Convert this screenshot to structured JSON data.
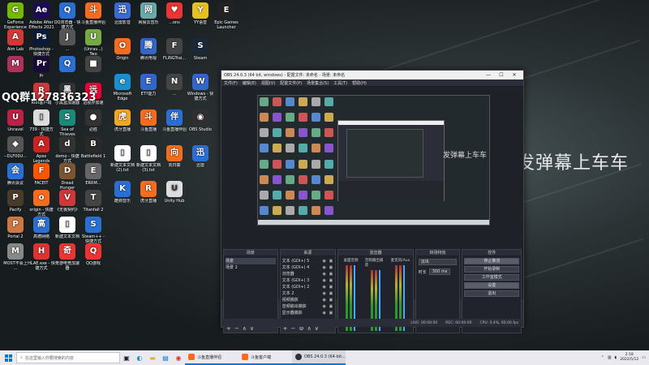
{
  "desktop": {
    "icons": [
      {
        "label": "GeForce Experience",
        "color": "#76b900",
        "glyph": "G"
      },
      {
        "label": "Adobe After Effects 2021",
        "color": "#1f0a5a",
        "glyph": "Ae"
      },
      {
        "label": "QQ浏览器 - 快捷方式",
        "color": "#2a6fd6",
        "glyph": "Q"
      },
      {
        "label": "斗鱼直播伴侣",
        "color": "#f56c1e",
        "glyph": "斗"
      },
      {
        "label": "Aim Lab",
        "color": "#d23838",
        "glyph": "A"
      },
      {
        "label": "Photoshop - 快捷方式",
        "color": "#0a1a3a",
        "glyph": "Ps"
      },
      {
        "label": "...",
        "color": "#555",
        "glyph": "J"
      },
      {
        "label": "(Unrav...) Two",
        "color": "#7a4",
        "glyph": "U"
      },
      {
        "label": "",
        "color": "#b0305a",
        "glyph": "M"
      },
      {
        "label": "Pr",
        "color": "#1a0a3a",
        "glyph": "Pr"
      },
      {
        "label": "",
        "color": "#2a6fd6",
        "glyph": "Q"
      },
      {
        "label": "",
        "color": "#444",
        "glyph": "■"
      },
      {
        "label": "QQ群127836323",
        "color": "transparent",
        "glyph": ""
      },
      {
        "label": "Riot客户端",
        "color": "#d13639",
        "glyph": "R"
      },
      {
        "label": "小黑盒加速器",
        "color": "#333",
        "glyph": "黑"
      },
      {
        "label": "远视界加速",
        "color": "#e03",
        "glyph": "远"
      },
      {
        "label": "Unravel",
        "color": "#b24",
        "glyph": "U"
      },
      {
        "label": "739 - 快捷方式",
        "color": "#ddd",
        "glyph": "▯"
      },
      {
        "label": "Sea of Thieves",
        "color": "#1a8a7a",
        "glyph": "S"
      },
      {
        "label": "必胜",
        "color": "#333",
        "glyph": "●"
      },
      {
        "label": "--DLF00U...",
        "color": "#555",
        "glyph": "◆"
      },
      {
        "label": "Apex Legends",
        "color": "#c22",
        "glyph": "A"
      },
      {
        "label": "demo - 快捷方式",
        "color": "#333",
        "glyph": "d"
      },
      {
        "label": "Battlefield 1",
        "color": "#2a2a2a",
        "glyph": "B"
      },
      {
        "label": "腾讯会议",
        "color": "#2a6fd6",
        "glyph": "会"
      },
      {
        "label": "FACEIT",
        "color": "#f50",
        "glyph": "F"
      },
      {
        "label": "Dread Hunger",
        "color": "#7a5530",
        "glyph": "D"
      },
      {
        "label": "ERRM...",
        "color": "#666",
        "glyph": "E"
      },
      {
        "label": "Pacify",
        "color": "#4a3a2a",
        "glyph": "P"
      },
      {
        "label": "origin - 快捷方式",
        "color": "#f56c1e",
        "glyph": "o"
      },
      {
        "label": "《无畏契约》",
        "color": "#d13639",
        "glyph": "V"
      },
      {
        "label": "Titanfall 2",
        "color": "#444",
        "glyph": "T"
      },
      {
        "label": "Portal 2",
        "color": "#c74",
        "glyph": "P"
      },
      {
        "label": "高德网络",
        "color": "#2a6fd6",
        "glyph": "高"
      },
      {
        "label": "新建文本文档",
        "color": "#fff",
        "glyph": "▯"
      },
      {
        "label": "Steam++ - 快捷方式",
        "color": "#2a6fd6",
        "glyph": "S"
      },
      {
        "label": "MOST不会上 ...",
        "color": "#888",
        "glyph": "M"
      },
      {
        "label": "HLAE.exe - 快捷方式",
        "color": "#d33",
        "glyph": "H"
      },
      {
        "label": "奇游电竞加速器",
        "color": "#e33",
        "glyph": "奇"
      },
      {
        "label": "QQ游戏",
        "color": "#e33",
        "glyph": "Q"
      }
    ],
    "top_row_right": [
      {
        "label": "迅雷影音",
        "color": "#3a6ad6",
        "glyph": "迅"
      },
      {
        "label": "网易云音乐",
        "color": "#6aa",
        "glyph": "网"
      },
      {
        "label": "...ons",
        "color": "#e33",
        "glyph": "♥"
      },
      {
        "label": "YY语音",
        "color": "#e8c020",
        "glyph": "Y"
      },
      {
        "label": "Epic Games Launcher",
        "color": "#222",
        "glyph": "E"
      },
      {
        "label": "Origin",
        "color": "#f56c1e",
        "glyph": "O"
      },
      {
        "label": "腾讯电视",
        "color": "#36c",
        "glyph": "腾"
      },
      {
        "label": "FLiNGTrai...",
        "color": "#444",
        "glyph": "F"
      },
      {
        "label": "Steam",
        "color": "#1b2838",
        "glyph": "S"
      },
      {
        "label": "RIDE 4",
        "color": "#0a1a3a",
        "glyph": "R"
      },
      {
        "label": "Microsoft Edge",
        "color": "#1a8fd0",
        "glyph": "e"
      },
      {
        "label": "ET?能力",
        "color": "#36c",
        "glyph": "E"
      },
      {
        "label": "...",
        "color": "#444",
        "glyph": "N"
      },
      {
        "label": "Windows - 快捷方式",
        "color": "#36c",
        "glyph": "W"
      },
      {
        "label": "Rengo... Murak...",
        "color": "#555",
        "glyph": "R"
      },
      {
        "label": "虎牙直播",
        "color": "#f5a623",
        "glyph": "虎"
      },
      {
        "label": "斗鱼直播",
        "color": "#f56c1e",
        "glyph": "斗"
      },
      {
        "label": "斗鱼直播伴侣",
        "color": "#2a6fd6",
        "glyph": "伴"
      },
      {
        "label": "OBS Studio",
        "color": "#302e31",
        "glyph": "◉"
      },
      {
        "label": "Terra...",
        "color": "#555",
        "glyph": "T"
      },
      {
        "label": "新建文本文档 (2).txt",
        "color": "#fff",
        "glyph": "▯"
      },
      {
        "label": "新建文本文档 (3).txt",
        "color": "#fff",
        "glyph": "▯"
      },
      {
        "label": "向日葵",
        "color": "#f56c1e",
        "glyph": "向"
      },
      {
        "label": "迅雷",
        "color": "#2a6fd6",
        "glyph": "迅"
      },
      {
        "label": "迅雷影音播放",
        "color": "#2a6fd6",
        "glyph": "迅"
      },
      {
        "label": "酷狗音乐",
        "color": "#2a6fd6",
        "glyph": "K"
      },
      {
        "label": "虎牙直播",
        "color": "#f56c1e",
        "glyph": "R"
      },
      {
        "label": "Unity Hub",
        "color": "#ddd",
        "glyph": "U"
      }
    ],
    "qq_banner": "QQ群127836323",
    "overlay_text": "发弹幕上车车"
  },
  "obs": {
    "title": "OBS 24.0.3 (64 bit, windows) - 配置文件: 未命名 - 场景: 未命名",
    "window_buttons": [
      "—",
      "☐",
      "✕"
    ],
    "menu": [
      "文件(F)",
      "编辑(E)",
      "视图(V)",
      "配置文件(P)",
      "场景集合(S)",
      "工具(T)",
      "帮助(H)"
    ],
    "canvas_overlay_text": "发弹幕上车车",
    "docks": {
      "scenes": {
        "title": "场景",
        "items": [
          {
            "label": "场景",
            "selected": true
          },
          {
            "label": "场景 2",
            "selected": false
          }
        ],
        "footer": [
          "+",
          "−",
          "∧",
          "∨"
        ]
      },
      "sources": {
        "title": "来源",
        "items": [
          {
            "label": "文本 (GDI+) 5"
          },
          {
            "label": "文本 (GDI+) 4"
          },
          {
            "label": "浏览器"
          },
          {
            "label": "文本 (GDI+) 3"
          },
          {
            "label": "文本 (GDI+) 2"
          },
          {
            "label": "文本 2"
          },
          {
            "label": "视频捕获"
          },
          {
            "label": "音频输出捕获"
          },
          {
            "label": "显示器捕获"
          }
        ],
        "footer": [
          "+",
          "−",
          "⚙",
          "∧",
          "∨"
        ]
      },
      "mixer": {
        "title": "混音器",
        "channels": [
          {
            "label": "桌面音频"
          },
          {
            "label": "音频输出捕获"
          },
          {
            "label": "麦克风/Aux"
          }
        ]
      },
      "transitions": {
        "title": "转场特效",
        "selected": "淡出",
        "duration_label": "时长",
        "duration_value": "300 ms"
      },
      "controls": {
        "title": "控件",
        "buttons": [
          "停止推流",
          "开始录制",
          "工作室模式",
          "设置",
          "退出"
        ]
      }
    },
    "status": {
      "live": "LIVE: 00:00:00",
      "rec": "REC: 00:00:00",
      "cpu": "CPU: 0.4%, 60.00 fps"
    }
  },
  "taskbar": {
    "search_placeholder": "在这里输入你要搜索的内容",
    "apps": [
      {
        "label": "斗鱼直播伴侣",
        "color": "#f56c1e"
      },
      {
        "label": "斗鱼客户端",
        "color": "#f56c1e"
      },
      {
        "label": "OBS 24.0.3 (64-bit...",
        "color": "#302e31"
      }
    ],
    "clock_time": "2:18",
    "clock_date": "2022/5/12"
  }
}
